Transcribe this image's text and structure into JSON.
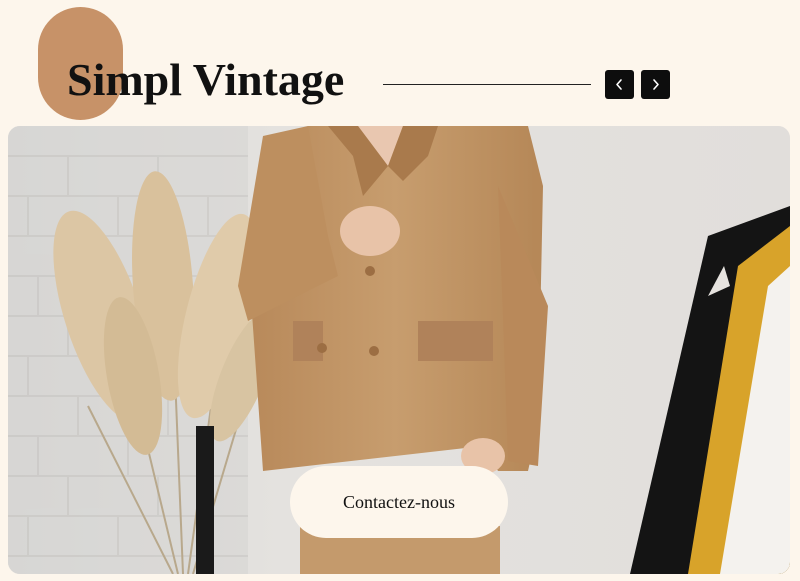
{
  "header": {
    "title": "Simpl Vintage",
    "prev_icon": "chevron-left-icon",
    "next_icon": "chevron-right-icon"
  },
  "hero": {
    "image_subject": "woman-in-camel-blazer-photo",
    "cta_label": "Contactez-nous"
  },
  "colors": {
    "background": "#fdf6ec",
    "accent_blob": "#c79268",
    "nav_button": "#0d0d0d",
    "blazer": "#c49a6c",
    "mustard": "#d8a32a"
  }
}
